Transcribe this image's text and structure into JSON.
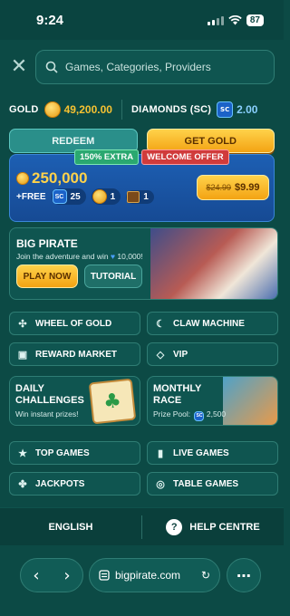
{
  "status": {
    "time": "9:24",
    "battery": "87"
  },
  "search": {
    "placeholder": "Games, Categories, Providers"
  },
  "currency": {
    "gold_label": "GOLD",
    "gold_value": "49,200.00",
    "diamonds_label": "DIAMONDS (SC)",
    "diamonds_value": "2.00"
  },
  "actions": {
    "redeem": "REDEEM",
    "get_gold": "GET GOLD"
  },
  "promo": {
    "tag_extra": "150% EXTRA",
    "tag_welcome": "WELCOME OFFER",
    "amount": "250,000",
    "free_label": "+FREE",
    "sc_bonus": "25",
    "coin_bonus": "1",
    "chest_bonus": "1",
    "old_price": "$24.99",
    "new_price": "$9.99"
  },
  "pirate": {
    "title": "BIG PIRATE",
    "subtitle": "Join the adventure and win",
    "prize": "10,000!",
    "play_now": "PLAY NOW",
    "tutorial": "TUTORIAL"
  },
  "tiles1": [
    {
      "label": "WHEEL OF GOLD",
      "icon": "wheel-icon"
    },
    {
      "label": "CLAW MACHINE",
      "icon": "claw-icon"
    },
    {
      "label": "REWARD MARKET",
      "icon": "bag-icon"
    },
    {
      "label": "VIP",
      "icon": "diamond-icon"
    }
  ],
  "features": {
    "daily_title": "DAILY\nCHALLENGES",
    "daily_sub": "Win instant prizes!",
    "race_title": "MONTHLY\nRACE",
    "race_sub": "Prize Pool:",
    "race_prize": "2,500"
  },
  "tiles2": [
    {
      "label": "TOP GAMES",
      "icon": "star-icon"
    },
    {
      "label": "LIVE GAMES",
      "icon": "cards-icon"
    },
    {
      "label": "JACKPOTS",
      "icon": "clover-icon"
    },
    {
      "label": "TABLE GAMES",
      "icon": "chip-icon"
    }
  ],
  "footer": {
    "language": "ENGLISH",
    "help": "HELP CENTRE",
    "help_icon": "?"
  },
  "browser": {
    "url": "bigpirate.com"
  }
}
